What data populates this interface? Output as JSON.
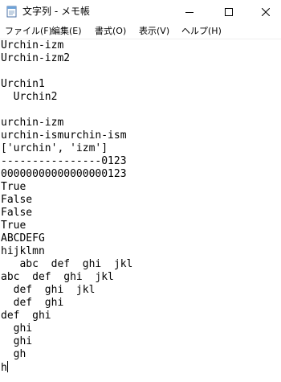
{
  "window": {
    "title": "文字列 - メモ帳",
    "icon": "notepad-icon"
  },
  "menu": {
    "items": [
      "ファイル(F)",
      "編集(E)",
      "書式(O)",
      "表示(V)",
      "ヘルプ(H)"
    ]
  },
  "editor": {
    "lines": [
      "Urchin-izm",
      "Urchin-izm2",
      "",
      "Urchin1",
      "  Urchin2",
      "",
      "urchin-izm",
      "urchin-ismurchin-ism",
      "['urchin', 'izm']",
      "----------------0123",
      "00000000000000000123",
      "True",
      "False",
      "False",
      "True",
      "ABCDEFG",
      "hijklmn",
      "   abc  def  ghi  jkl",
      "abc  def  ghi  jkl",
      "  def  ghi  jkl",
      "  def  ghi",
      "def  ghi",
      "  ghi",
      "  ghi",
      "  gh",
      "h"
    ]
  }
}
